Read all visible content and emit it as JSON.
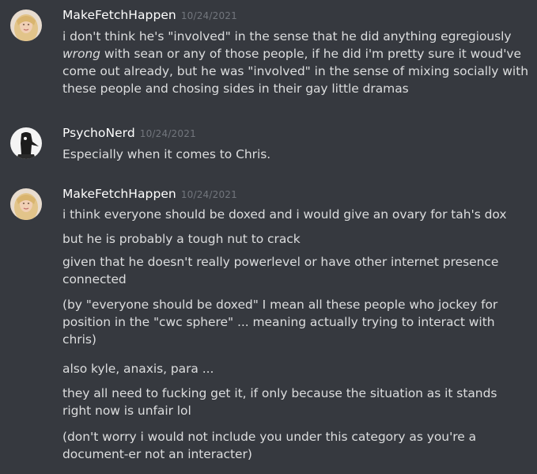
{
  "messages": [
    {
      "author": "MakeFetchHappen",
      "timestamp": "10/24/2021",
      "avatar": "blonde-woman-avatar",
      "lines": [
        {
          "pre": "i don't think he's \"involved\" in the sense that he did anything egregiously",
          "emphasis": "wrong",
          "post": "with sean or any of those people, if he did i'm pretty sure it woud've come out already, but he was \"involved\" in the sense of mixing socially with these people and chosing sides in their gay little dramas"
        }
      ]
    },
    {
      "author": "PsychoNerd",
      "timestamp": "10/24/2021",
      "avatar": "plague-doctor-avatar",
      "lines": [
        {
          "text": "Especially when it comes to Chris."
        }
      ]
    },
    {
      "author": "MakeFetchHappen",
      "timestamp": "10/24/2021",
      "avatar": "blonde-woman-avatar",
      "lines": [
        {
          "text": "i think everyone should be doxed and i would give an ovary for tah's dox"
        },
        {
          "text": "but he is probably a tough nut to crack"
        },
        {
          "text": "given that he doesn't really powerlevel or have other internet presence connected"
        },
        {
          "text": "(by \"everyone should be doxed\" I mean all these people who jockey for position in the \"cwc sphere\" ... meaning actually trying to interact with chris)"
        },
        {
          "text": "also kyle, anaxis, para ..."
        },
        {
          "text": "they all need to fucking get it, if only because the situation as it stands right now is unfair lol"
        },
        {
          "text": "(don't worry i would not include you under this category as you're a document-er not an interacter)"
        }
      ]
    }
  ]
}
